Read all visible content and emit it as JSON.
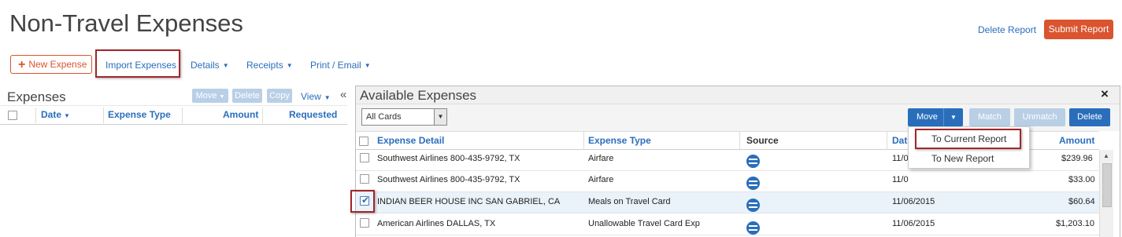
{
  "header": {
    "title": "Non-Travel Expenses",
    "delete_report": "Delete Report",
    "submit_report": "Submit Report"
  },
  "toolbar": {
    "new_expense": "New Expense",
    "import_expenses": "Import Expenses",
    "details": "Details",
    "receipts": "Receipts",
    "print_email": "Print / Email"
  },
  "left_panel": {
    "title": "Expenses",
    "move": "Move",
    "delete": "Delete",
    "copy": "Copy",
    "view": "View",
    "collapse_icon": "double-chevron-left",
    "columns": {
      "date": "Date",
      "expense_type": "Expense Type",
      "amount": "Amount",
      "requested": "Requested"
    }
  },
  "available": {
    "title": "Available Expenses",
    "close": "×",
    "cards_select": "All Cards",
    "move": "Move",
    "match": "Match",
    "unmatch": "Unmatch",
    "delete": "Delete",
    "columns": {
      "detail": "Expense Detail",
      "type": "Expense Type",
      "source": "Source",
      "date": "Date",
      "amount": "Amount"
    },
    "move_menu": {
      "to_current": "To Current Report",
      "to_new": "To New Report"
    },
    "rows": [
      {
        "detail": "Southwest Airlines 800-435-9792, TX",
        "type": "Airfare",
        "date": "11/0",
        "amount": "$239.96",
        "checked": false,
        "source_icon": "card-icon"
      },
      {
        "detail": "Southwest Airlines 800-435-9792, TX",
        "type": "Airfare",
        "date": "11/0",
        "amount": "$33.00",
        "checked": false,
        "source_icon": "card-icon"
      },
      {
        "detail": "INDIAN BEER HOUSE INC SAN GABRIEL, CA",
        "type": "Meals on Travel Card",
        "date": "11/06/2015",
        "amount": "$60.64",
        "checked": true,
        "source_icon": "card-icon"
      },
      {
        "detail": "American Airlines DALLAS, TX",
        "type": "Unallowable Travel Card Exp",
        "date": "11/06/2015",
        "amount": "$1,203.10",
        "checked": false,
        "source_icon": "card-icon"
      }
    ]
  },
  "colors": {
    "accent": "#2a6ebb",
    "submit": "#d9542f",
    "highlight": "#a3262b"
  }
}
